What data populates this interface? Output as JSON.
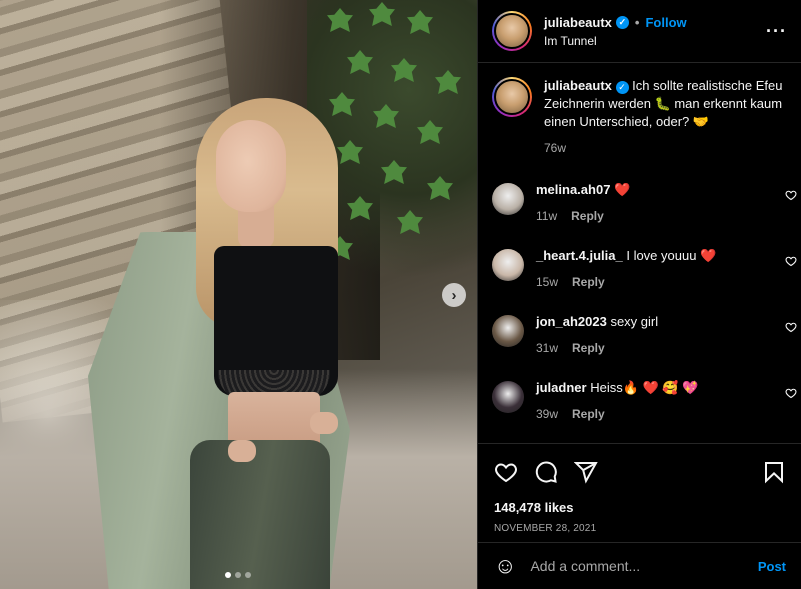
{
  "post": {
    "username": "juliabeautx",
    "follow_label": "Follow",
    "separator": "•",
    "location": "Im Tunnel",
    "more_label": "···",
    "carousel": {
      "slide_count": 3,
      "active_slide": 1,
      "next_glyph": "›"
    }
  },
  "caption": {
    "username": "juliabeautx",
    "text": "Ich sollte realistische Efeu Zeichnerin werden 🐛 man erkennt kaum einen Unterschied, oder? 🤝",
    "time": "76w"
  },
  "comments": [
    {
      "username": "melina.ah07",
      "text": "❤️",
      "time": "11w",
      "reply": "Reply",
      "avatar_color": "#b9b0a6"
    },
    {
      "username": "_heart.4.julia_",
      "text": "I love youuu ❤️",
      "time": "15w",
      "reply": "Reply",
      "avatar_color": "#c9b7a8"
    },
    {
      "username": "jon_ah2023",
      "text": "sexy girl",
      "time": "31w",
      "reply": "Reply",
      "avatar_color": "#6a5846"
    },
    {
      "username": "juladner",
      "text": "Heiss🔥 ❤️ 🥰 💖",
      "time": "39w",
      "reply": "Reply",
      "avatar_color": "#3a2f38"
    }
  ],
  "actions": {
    "likes": "148,478 likes",
    "date": "NOVEMBER 28, 2021"
  },
  "add_comment": {
    "placeholder": "Add a comment...",
    "post_label": "Post",
    "emoji_glyph": "☺"
  },
  "colors": {
    "accent": "#0095f6",
    "like_red": "#ed2b3b",
    "background": "#000000",
    "secondary_text": "#a8a8a8"
  }
}
